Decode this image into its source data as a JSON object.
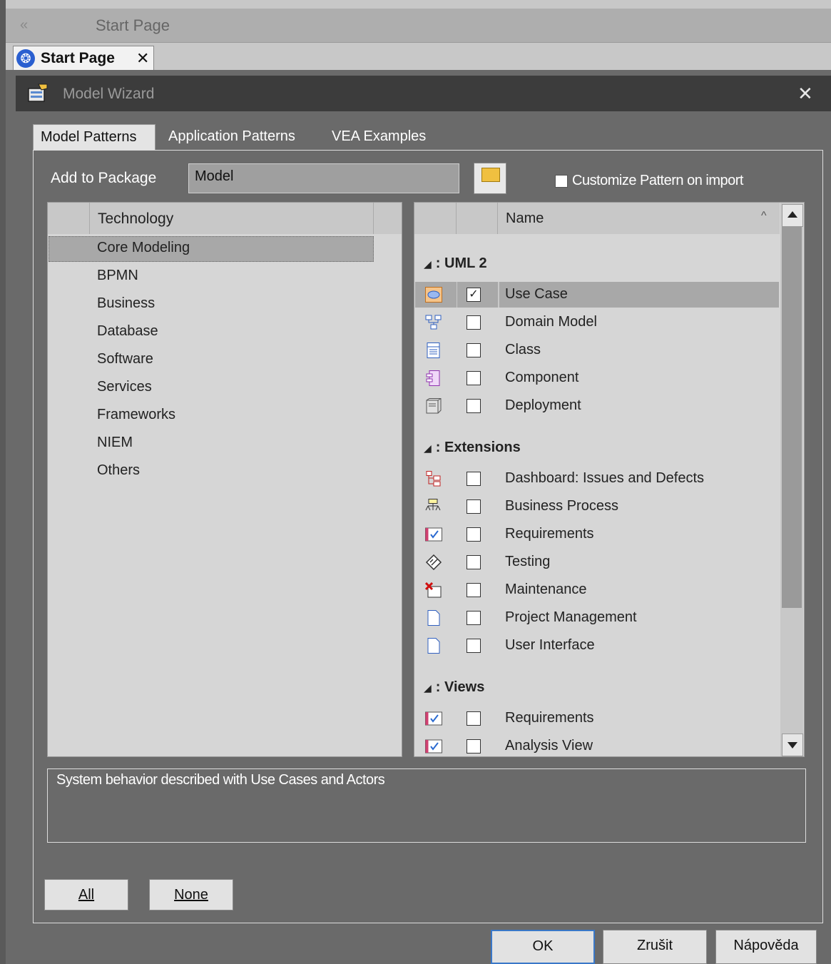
{
  "breadcrumb": {
    "back_glyph": "«",
    "title": "Start Page"
  },
  "doc_tab": {
    "label": "Start Page",
    "close": "✕",
    "icon": "start-page-icon"
  },
  "dialog": {
    "title": "Model Wizard",
    "close": "✕",
    "tabs": [
      "Model Patterns",
      "Application Patterns",
      "VEA Examples"
    ],
    "active_tab": "Model Patterns",
    "add_to_package_label": "Add to Package",
    "package_value": "Model",
    "customize_label": "Customize Pattern on import",
    "customize_checked": false,
    "technology": {
      "header": "Technology",
      "selected": "Core Modeling",
      "items": [
        "Core Modeling",
        "BPMN",
        "Business",
        "Database",
        "Software",
        "Services",
        "Frameworks",
        "NIEM",
        "Others"
      ]
    },
    "patterns": {
      "header": "Name",
      "sort_glyph": "^",
      "groups": [
        {
          "title": ": UML 2",
          "items": [
            {
              "name": "Use Case",
              "checked": true,
              "icon": "use-case-icon"
            },
            {
              "name": "Domain Model",
              "checked": false,
              "icon": "domain-model-icon"
            },
            {
              "name": "Class",
              "checked": false,
              "icon": "class-icon"
            },
            {
              "name": "Component",
              "checked": false,
              "icon": "component-icon"
            },
            {
              "name": "Deployment",
              "checked": false,
              "icon": "deployment-icon"
            }
          ]
        },
        {
          "title": ": Extensions",
          "items": [
            {
              "name": "Dashboard: Issues and Defects",
              "checked": false,
              "icon": "dashboard-icon"
            },
            {
              "name": "Business Process",
              "checked": false,
              "icon": "business-process-icon"
            },
            {
              "name": "Requirements",
              "checked": false,
              "icon": "requirements-icon"
            },
            {
              "name": "Testing",
              "checked": false,
              "icon": "testing-icon"
            },
            {
              "name": "Maintenance",
              "checked": false,
              "icon": "maintenance-icon"
            },
            {
              "name": "Project Management",
              "checked": false,
              "icon": "document-icon"
            },
            {
              "name": "User Interface",
              "checked": false,
              "icon": "document-icon"
            }
          ]
        },
        {
          "title": ": Views",
          "items": [
            {
              "name": "Requirements",
              "checked": false,
              "icon": "requirements-icon"
            },
            {
              "name": "Analysis View",
              "checked": false,
              "icon": "requirements-icon"
            }
          ]
        }
      ]
    },
    "description": "System behavior described with Use Cases and Actors",
    "buttons": {
      "all": "All",
      "none": "None",
      "ok": "OK",
      "cancel": "Zrušit",
      "help": "Nápověda"
    }
  }
}
